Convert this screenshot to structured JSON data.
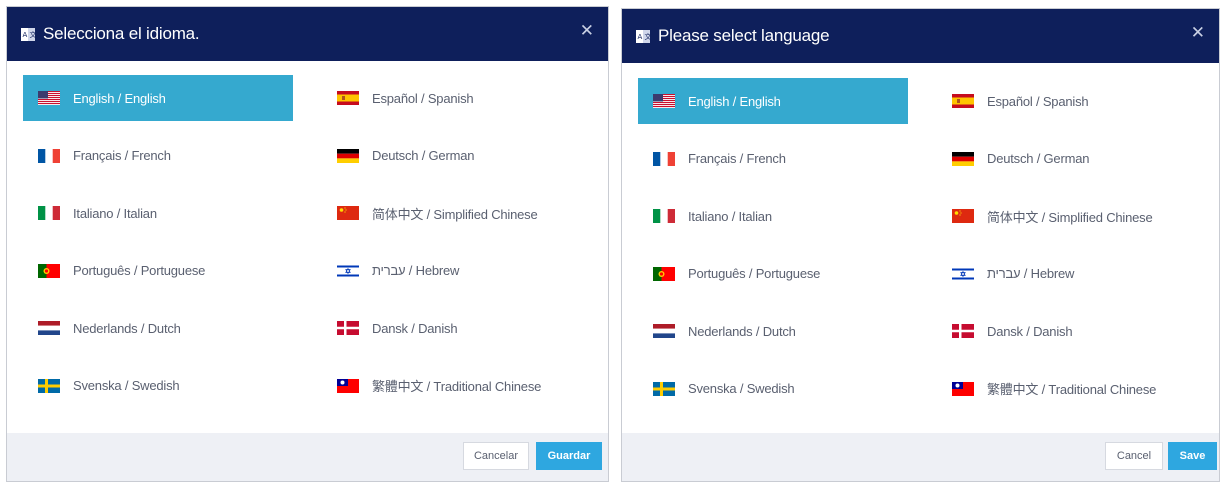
{
  "dialogs": [
    {
      "title": "Selecciona el idioma.",
      "cancel_label": "Cancelar",
      "confirm_label": "Guardar"
    },
    {
      "title": "Please select language",
      "cancel_label": "Cancel",
      "confirm_label": "Save"
    }
  ],
  "languages": [
    {
      "label": "English / English",
      "flag": "us-flag-icon",
      "selected": true
    },
    {
      "label": "Español / Spanish",
      "flag": "spain-flag-icon",
      "selected": false
    },
    {
      "label": "Français / French",
      "flag": "france-flag-icon",
      "selected": false
    },
    {
      "label": "Deutsch / German",
      "flag": "germany-flag-icon",
      "selected": false
    },
    {
      "label": "Italiano / Italian",
      "flag": "italy-flag-icon",
      "selected": false
    },
    {
      "label": "简体中文 / Simplified Chinese",
      "flag": "china-flag-icon",
      "selected": false
    },
    {
      "label": "Português / Portuguese",
      "flag": "portugal-flag-icon",
      "selected": false
    },
    {
      "label": "עברית / Hebrew",
      "flag": "israel-flag-icon",
      "selected": false
    },
    {
      "label": "Nederlands / Dutch",
      "flag": "netherlands-flag-icon",
      "selected": false
    },
    {
      "label": "Dansk / Danish",
      "flag": "denmark-flag-icon",
      "selected": false
    },
    {
      "label": "Svenska / Swedish",
      "flag": "sweden-flag-icon",
      "selected": false
    },
    {
      "label": "繁體中文 / Traditional Chinese",
      "flag": "taiwan-flag-icon",
      "selected": false
    }
  ],
  "colors": {
    "header_bg": "#0e1f5b",
    "selected_bg": "#35a9cf",
    "primary_button": "#2ea7e0",
    "footer_bg": "#eef0f5"
  }
}
